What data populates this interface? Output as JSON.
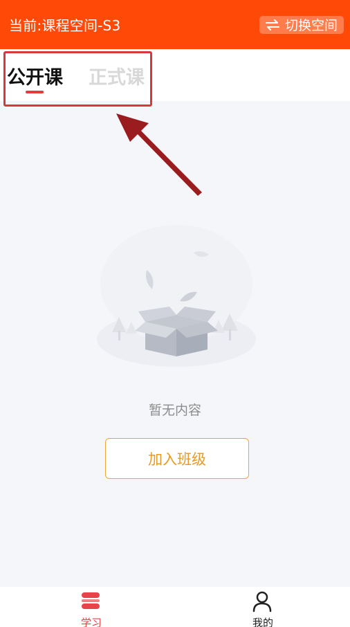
{
  "header": {
    "title": "当前:课程空间-S3",
    "switch_label": "切换空间",
    "switch_icon": "swap-arrows-icon",
    "background": "#ff4a07"
  },
  "tabs": [
    {
      "label": "公开课",
      "active": true
    },
    {
      "label": "正式课",
      "active": false
    }
  ],
  "empty_state": {
    "message": "暂无内容",
    "illustration": "empty-box-icon"
  },
  "join_button": {
    "label": "加入班级",
    "color": "#ea9a22"
  },
  "bottom_nav": [
    {
      "label": "学习",
      "icon": "study-icon",
      "active": true,
      "color": "#e8424a"
    },
    {
      "label": "我的",
      "icon": "user-icon",
      "active": false,
      "color": "#222222"
    }
  ],
  "annotation": {
    "color": "#d9363e"
  }
}
